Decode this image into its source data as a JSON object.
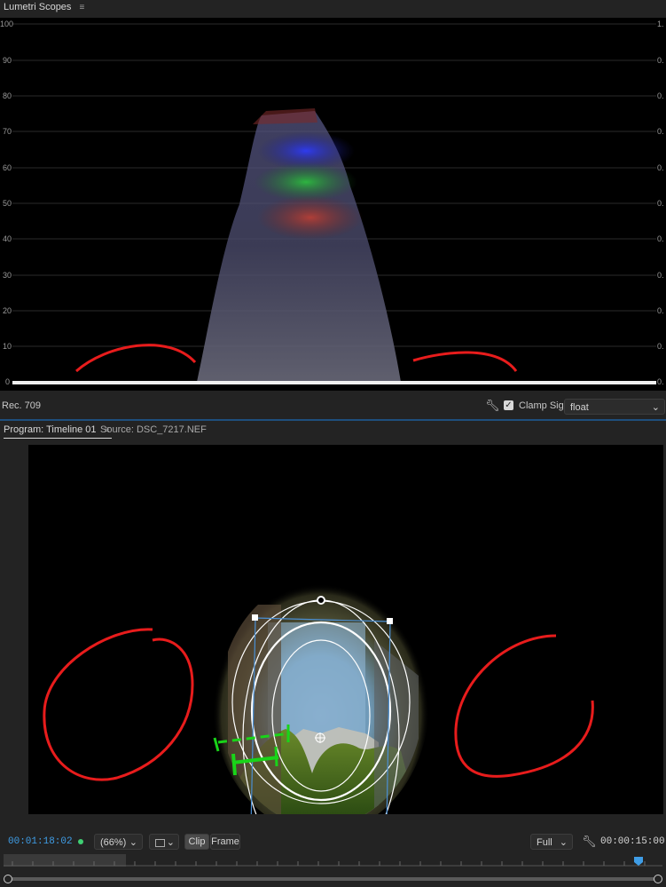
{
  "scopes_panel": {
    "tab_label": "Lumetri Scopes",
    "y_axis_left": [
      "100",
      "90",
      "80",
      "70",
      "60",
      "50",
      "40",
      "30",
      "20",
      "10",
      "0"
    ],
    "y_axis_right": [
      "1.",
      "0.",
      "0.",
      "0.",
      "0.",
      "0.",
      "0.",
      "0.",
      "0.",
      "0.",
      "0."
    ],
    "colorspace_label": "Rec. 709",
    "clamp_signal": {
      "label": "Clamp Signal",
      "checked": true
    },
    "precision_select": "float"
  },
  "program_panel": {
    "tab_program": "Program: Timeline 01",
    "tab_source": "Source: DSC_7217.NEF",
    "current_timecode": "00:01:18:02",
    "zoom_select": "(66%)",
    "clip_button": "Clip",
    "frame_button": "Frame",
    "resolution_select": "Full",
    "duration_timecode": "00:00:15:00"
  },
  "colors": {
    "accent_blue": "#3f9de6",
    "annotation_red": "#e81c1c",
    "annotation_green": "#19d419",
    "status_green": "#3fcf73"
  }
}
